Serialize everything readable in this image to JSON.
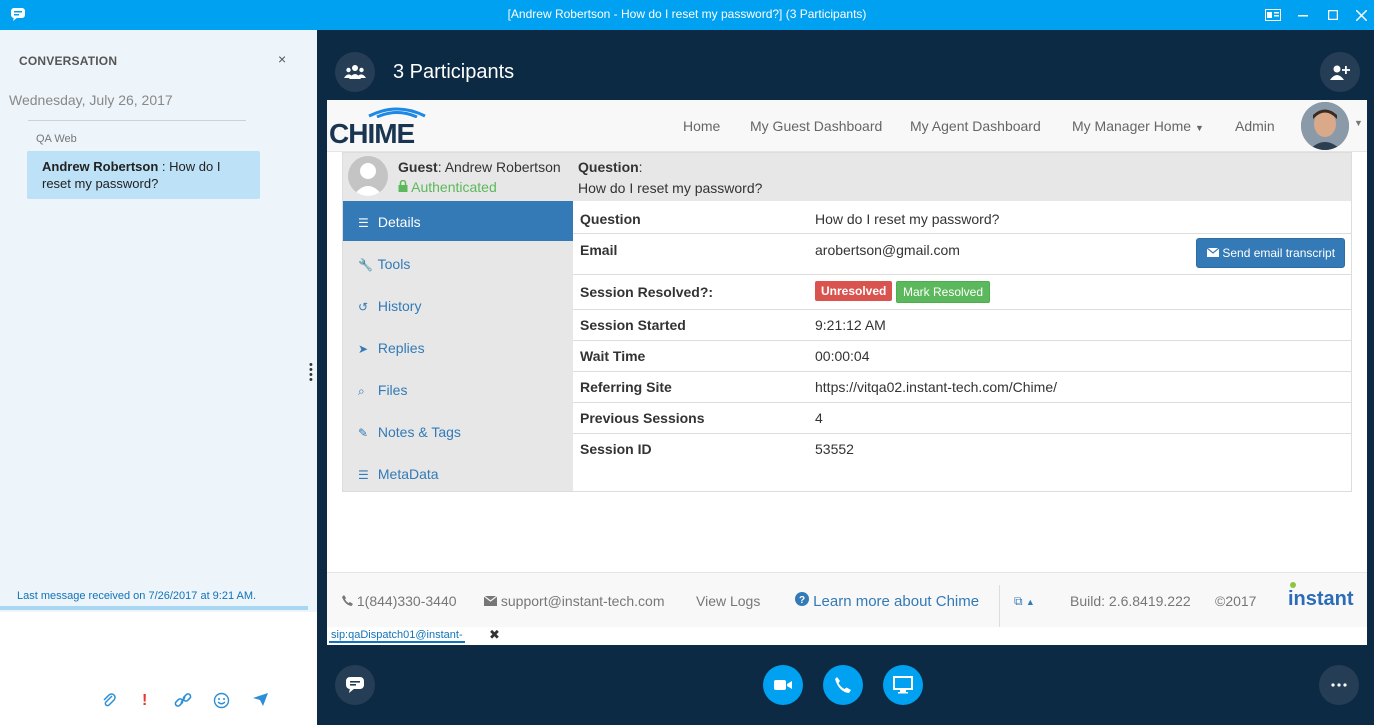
{
  "window": {
    "title": "[Andrew Robertson - How do I reset my password?] (3 Participants)"
  },
  "conversation": {
    "header": "CONVERSATION",
    "close_glyph": "×",
    "date": "Wednesday, July 26, 2017",
    "sender": "QA Web",
    "message_author": "Andrew Robertson",
    "message_text": " : How do I reset my password?",
    "last_message": "Last message received on 7/26/2017 at 9:21 AM."
  },
  "call": {
    "participants": "3 Participants"
  },
  "webapp": {
    "logo": "CHIME",
    "nav": {
      "home": "Home",
      "guest_dashboard": "My Guest Dashboard",
      "agent_dashboard": "My Agent Dashboard",
      "manager_home": "My Manager Home",
      "admin": "Admin"
    },
    "guest": {
      "label": "Guest",
      "name": ": Andrew Robertson",
      "status": "Authenticated",
      "question_label": "Question",
      "question_suffix": ":",
      "question": "How do I reset my password?"
    },
    "sidebar": [
      {
        "label": "Details",
        "icon": "list-icon"
      },
      {
        "label": "Tools",
        "icon": "wrench-icon"
      },
      {
        "label": "History",
        "icon": "history-icon"
      },
      {
        "label": "Replies",
        "icon": "send-icon"
      },
      {
        "label": "Files",
        "icon": "paperclip-icon"
      },
      {
        "label": "Notes & Tags",
        "icon": "edit-icon"
      },
      {
        "label": "MetaData",
        "icon": "list-icon"
      }
    ],
    "details": {
      "question_k": "Question",
      "question_v": "How do I reset my password?",
      "email_k": "Email",
      "email_v": "arobertson@gmail.com",
      "send_transcript": "Send email transcript",
      "resolved_k": "Session Resolved?:",
      "unresolved": "Unresolved",
      "mark_resolved": "Mark Resolved",
      "started_k": "Session Started",
      "started_v": "9:21:12 AM",
      "wait_k": "Wait Time",
      "wait_v": "00:00:04",
      "referring_k": "Referring Site",
      "referring_v": "https://vitqa02.instant-tech.com/Chime/",
      "previous_k": "Previous Sessions",
      "previous_v": "4",
      "sessionid_k": "Session ID",
      "sessionid_v": "53552"
    },
    "footer": {
      "phone": "1(844)330-3440",
      "email": "support@instant-tech.com",
      "view_logs": "View Logs",
      "learn_more": "Learn more about Chime",
      "build": "Build: 2.6.8419.222",
      "copyright": "©2017",
      "brand": "instant"
    }
  },
  "sip_tab": "sip:qaDispatch01@instant-",
  "colors": {
    "titlebar": "#00a1f1",
    "call_bg": "#0c2a44",
    "primary": "#337ab7",
    "danger": "#d9534f",
    "success": "#5cb85c"
  }
}
